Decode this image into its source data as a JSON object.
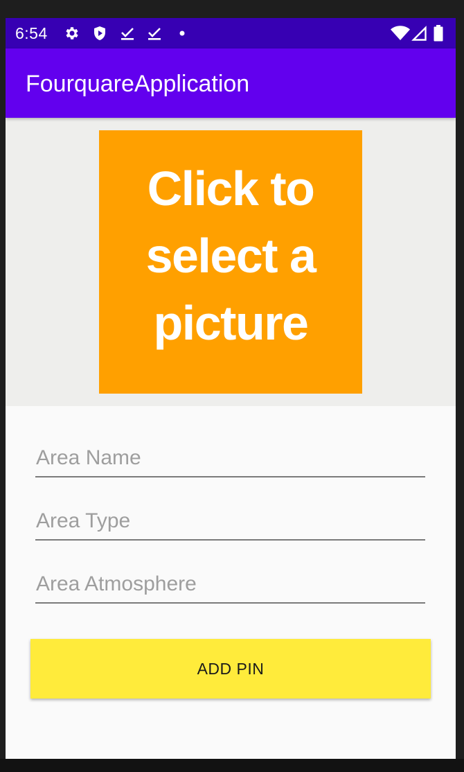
{
  "status_bar": {
    "time": "6:54",
    "icons_left": [
      "gear-icon",
      "shield-play-icon",
      "download-check-icon",
      "download-check-icon",
      "dot-icon"
    ],
    "icons_right": [
      "wifi-icon",
      "signal-icon",
      "battery-icon"
    ]
  },
  "app_bar": {
    "title": "FourquareApplication"
  },
  "picture_button": {
    "label": "Click to\nselect a\npicture"
  },
  "form": {
    "area_name": {
      "value": "",
      "placeholder": "Area Name"
    },
    "area_type": {
      "value": "",
      "placeholder": "Area Type"
    },
    "area_atmosphere": {
      "value": "",
      "placeholder": "Area Atmosphere"
    }
  },
  "add_pin_button": {
    "label": "ADD PIN"
  },
  "colors": {
    "status_bar": "#3700b3",
    "app_bar": "#6200ee",
    "picture_button": "#ffa000",
    "add_pin_button": "#ffeb3b",
    "image_area_background": "#eeeeec"
  }
}
